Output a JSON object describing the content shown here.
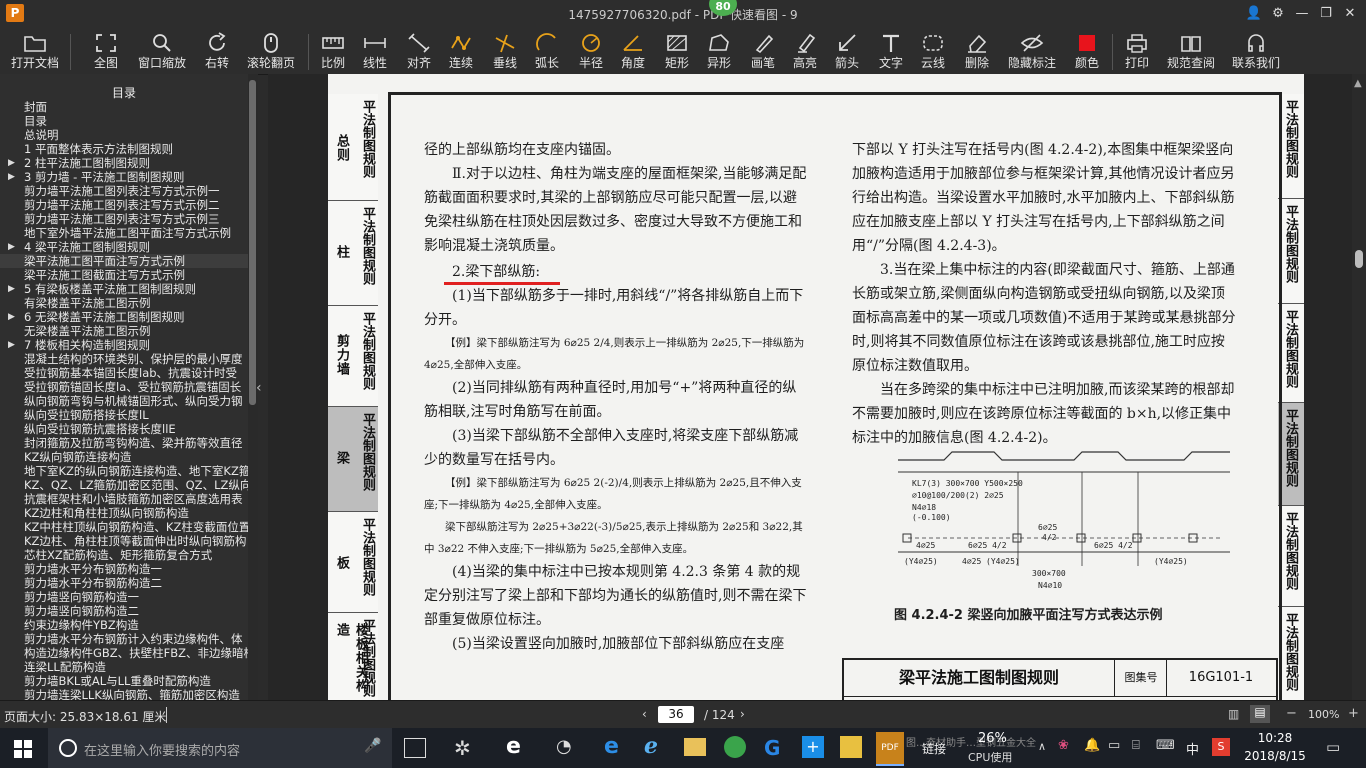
{
  "window": {
    "title": "1475927706320.pdf - PDF 快速看图 - 9",
    "badge": "80",
    "logo": "P"
  },
  "toolbar": [
    "打开文档",
    "全图",
    "窗口缩放",
    "右转",
    "滚轮翻页",
    "比例",
    "线性",
    "对齐",
    "连续",
    "垂线",
    "弧长",
    "半径",
    "角度",
    "矩形",
    "异形",
    "画笔",
    "高亮",
    "箭头",
    "文字",
    "云线",
    "删除",
    "隐藏标注",
    "颜色",
    "打印",
    "规范查阅",
    "联系我们"
  ],
  "sidebar": {
    "header": "目录",
    "items": [
      {
        "label": "封面",
        "arrow": ""
      },
      {
        "label": "目录",
        "arrow": ""
      },
      {
        "label": "总说明",
        "arrow": ""
      },
      {
        "label": "1 平面整体表示方法制图规则",
        "arrow": ""
      },
      {
        "label": "2 柱平法施工图制图规则",
        "arrow": "▶"
      },
      {
        "label": "3 剪力墙 - 平法施工图制图规则",
        "arrow": "▶"
      },
      {
        "label": "剪力墙平法施工图列表注写方式示例一",
        "arrow": ""
      },
      {
        "label": "剪力墙平法施工图列表注写方式示例二",
        "arrow": ""
      },
      {
        "label": "剪力墙平法施工图列表注写方式示例三",
        "arrow": ""
      },
      {
        "label": "地下室外墙平法施工图平面注写方式示例",
        "arrow": ""
      },
      {
        "label": "4 梁平法施工图制图规则",
        "arrow": "▶"
      },
      {
        "label": "梁平法施工图平面注写方式示例",
        "arrow": "",
        "sel": true
      },
      {
        "label": "梁平法施工图截面注写方式示例",
        "arrow": ""
      },
      {
        "label": "5 有梁板楼盖平法施工图制图规则",
        "arrow": "▶"
      },
      {
        "label": "有梁楼盖平法施工图示例",
        "arrow": ""
      },
      {
        "label": "6 无梁楼盖平法施工图制图规则",
        "arrow": "▶"
      },
      {
        "label": "无梁楼盖平法施工图示例",
        "arrow": ""
      },
      {
        "label": "7 楼板相关构造制图规则",
        "arrow": "▶"
      },
      {
        "label": "混凝土结构的环境类别、保护层的最小厚度",
        "arrow": ""
      },
      {
        "label": "受拉钢筋基本锚固长度lab、抗震设计时受",
        "arrow": ""
      },
      {
        "label": "受拉钢筋锚固长度la、受拉钢筋抗震锚固长",
        "arrow": ""
      },
      {
        "label": "纵向钢筋弯钩与机械锚固形式、纵向受力钢",
        "arrow": ""
      },
      {
        "label": "纵向受拉钢筋搭接长度lL",
        "arrow": ""
      },
      {
        "label": "纵向受拉钢筋抗震搭接长度llE",
        "arrow": ""
      },
      {
        "label": "封闭箍筋及拉筋弯钩构造、梁并筋等效直径",
        "arrow": ""
      },
      {
        "label": "KZ纵向钢筋连接构造",
        "arrow": ""
      },
      {
        "label": "地下室KZ的纵向钢筋连接构造、地下室KZ箍",
        "arrow": ""
      },
      {
        "label": "KZ、QZ、LZ箍筋加密区范围、QZ、LZ纵向钢",
        "arrow": ""
      },
      {
        "label": "抗震框架柱和小墙肢箍筋加密区高度选用表",
        "arrow": ""
      },
      {
        "label": "KZ边柱和角柱柱顶纵向钢筋构造",
        "arrow": ""
      },
      {
        "label": "KZ中柱柱顶纵向钢筋构造、KZ柱变截面位置",
        "arrow": ""
      },
      {
        "label": "KZ边柱、角柱柱顶等截面伸出时纵向钢筋构",
        "arrow": ""
      },
      {
        "label": "芯柱XZ配筋构造、矩形箍筋复合方式",
        "arrow": ""
      },
      {
        "label": "剪力墙水平分布钢筋构造一",
        "arrow": ""
      },
      {
        "label": "剪力墙水平分布钢筋构造二",
        "arrow": ""
      },
      {
        "label": "剪力墙竖向钢筋构造一",
        "arrow": ""
      },
      {
        "label": "剪力墙竖向钢筋构造二",
        "arrow": ""
      },
      {
        "label": "约束边缘构件YBZ构造",
        "arrow": ""
      },
      {
        "label": "剪力墙水平分布钢筋计入约束边缘构件、体",
        "arrow": ""
      },
      {
        "label": "构造边缘构件GBZ、扶壁柱FBZ、非边缘暗柱",
        "arrow": ""
      },
      {
        "label": "连梁LL配筋构造",
        "arrow": ""
      },
      {
        "label": "剪力墙BKL或AL与LL重叠时配筋构造",
        "arrow": ""
      },
      {
        "label": "剪力墙连梁LLK纵向钢筋、箍筋加密区构造",
        "arrow": ""
      }
    ]
  },
  "left_tabs": [
    {
      "big": "总则",
      "small": "平法制图规则"
    },
    {
      "big": "柱",
      "small": "平法制图规则"
    },
    {
      "big": "剪力墙",
      "small": "平法制图规则"
    },
    {
      "big": "梁",
      "small": "平法制图规则"
    },
    {
      "big": "板",
      "small": "平法制图规则"
    },
    {
      "big": "楼板相关构造",
      "small": "平法制图规则"
    }
  ],
  "right_tabs": [
    "平法制图规则",
    "平法制图规则",
    "平法制图规则",
    "平法制图规则",
    "平法制图规则",
    "平法制图规则"
  ],
  "document": {
    "left_column": [
      "径的上部纵筋均在支座内锚固。",
      "Ⅱ.对于以边柱、角柱为端支座的屋面框架梁,当能够满足配筋截面面积要求时,其梁的上部钢筋应尽可能只配置一层,以避免梁柱纵筋在柱顶处因层数过多、密度过大导致不方便施工和影响混凝土浇筑质量。",
      "2.梁下部纵筋:",
      "(1)当下部纵筋多于一排时,用斜线“/”将各排纵筋自上而下分开。",
      "【例】梁下部纵筋注写为 6⌀25 2/4,则表示上一排纵筋为 2⌀25,下一排纵筋为 4⌀25,全部伸入支座。",
      "(2)当同排纵筋有两种直径时,用加号“+”将两种直径的纵筋相联,注写时角筋写在前面。",
      "(3)当梁下部纵筋不全部伸入支座时,将梁支座下部纵筋减少的数量写在括号内。",
      "【例】梁下部纵筋注写为 6⌀25 2(-2)/4,则表示上排纵筋为 2⌀25,且不伸入支座;下一排纵筋为 4⌀25,全部伸入支座。",
      "梁下部纵筋注写为 2⌀25+3⌀22(-3)/5⌀25,表示上排纵筋为 2⌀25和 3⌀22,其中 3⌀22 不伸入支座;下一排纵筋为 5⌀25,全部伸入支座。",
      "(4)当梁的集中标注中已按本规则第 4.2.3 条第 4 款的规定分别注写了梁上部和下部均为通长的纵筋值时,则不需在梁下部重复做原位标注。",
      "(5)当梁设置竖向加腋时,加腋部位下部斜纵筋应在支座"
    ],
    "right_column": [
      "下部以 Y 打头注写在括号内(图 4.2.4-2),本图集中框架梁竖向加腋构造适用于加腋部位参与框架梁计算,其他情况设计者应另行给出构造。当梁设置水平加腋时,水平加腋内上、下部斜纵筋应在加腋支座上部以 Y 打头注写在括号内,上下部斜纵筋之间用“/”分隔(图 4.2.4-3)。",
      "3.当在梁上集中标注的内容(即梁截面尺寸、箍筋、上部通长筋或架立筋,梁侧面纵向构造钢筋或受扭纵向钢筋,以及梁顶面标高高差中的某一项或几项数值)不适用于某跨或某悬挑部分时,则将其不同数值原位标注在该跨或该悬挑部位,施工时应按原位标注数值取用。",
      "当在多跨梁的集中标注中已注明加腋,而该梁某跨的根部却不需要加腋时,则应在该跨原位标注等截面的 b×h,以修正集中标注中的加腋信息(图 4.2.4-2)。"
    ],
    "figure": {
      "caption": "图 4.2.4-2 梁竖向加腋平面注写方式表达示例",
      "labels": [
        "KL7(3) 300×700 Y500×250",
        "⌀10@100/200(2) 2⌀25",
        "N4⌀18",
        "(-0.100)",
        "6⌀25",
        "4/2",
        "4⌀25",
        "6⌀25 4/2",
        "(Y4⌀25)",
        "300×700",
        "N4⌀10"
      ]
    },
    "title_block": {
      "title": "梁平法施工图制图规则",
      "label": "图集号",
      "code": "16G101-1"
    }
  },
  "status": {
    "page_size": "页面大小: 25.83×18.61 厘米",
    "page": "36",
    "total": "/ 124",
    "zoom": "100%"
  },
  "taskbar": {
    "search_placeholder": "在这里输入你要搜索的内容",
    "cpu": "26%",
    "cpu_label": "CPU使用",
    "ticker": "图…奋材助手…型钢五金大全",
    "link": "链接",
    "ime": "中",
    "time": "10:28",
    "date": "2018/8/15"
  }
}
